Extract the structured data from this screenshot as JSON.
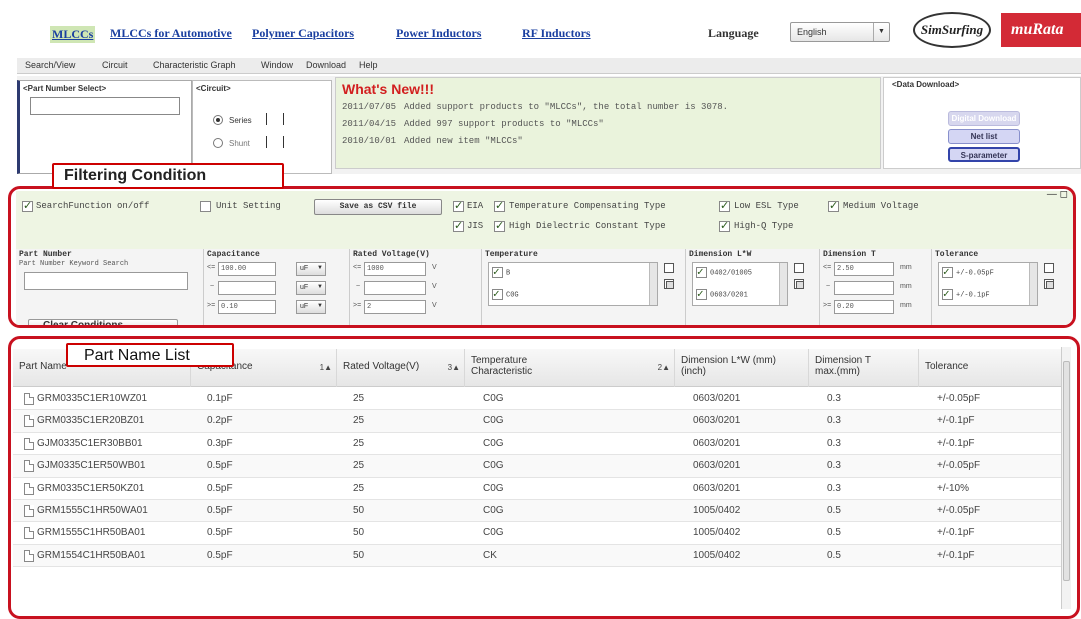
{
  "header": {
    "links": [
      "MLCCs",
      "MLCCs for Automotive",
      "Polymer Capacitors",
      "Power Inductors",
      "RF Inductors"
    ],
    "language_label": "Language",
    "language_value": "English",
    "simsurfing_logo": "SimSurfing",
    "brand_logo": "muRata"
  },
  "menu": [
    "Search/View",
    "Circuit",
    "Characteristic Graph",
    "Window",
    "Download",
    "Help"
  ],
  "part_select": {
    "label": "<Part Number Select>",
    "value": ""
  },
  "circuit": {
    "label": "<Circuit>",
    "options": [
      "Series",
      "Shunt"
    ],
    "selected": "Series"
  },
  "whats_new": {
    "title": "What's New!!!",
    "items": [
      {
        "date": "2011/07/05",
        "text": "Added support products to \"MLCCs\", the total number is 3078."
      },
      {
        "date": "2011/04/15",
        "text": "Added 997 support products to \"MLCCs\""
      },
      {
        "date": "2010/10/01",
        "text": "Added new item \"MLCCs\""
      }
    ]
  },
  "data_download": {
    "label": "<Data Download>",
    "buttons": [
      "Digital Download",
      "Net list",
      "S-parameter"
    ]
  },
  "filtering": {
    "callout": "Filtering Condition",
    "search_function": "SearchFunction on/off",
    "unit_setting": "Unit Setting",
    "save_csv": "Save as CSV file",
    "types_row1": [
      "EIA",
      "Temperature Compensating Type",
      "Low ESL Type",
      "Medium Voltage"
    ],
    "types_row2": [
      "JIS",
      "High Dielectric Constant Type",
      "High-Q Type"
    ],
    "part_number": {
      "title": "Part Number",
      "sub": "Part Number Keyword Search"
    },
    "capacitance": {
      "title": "Capacitance",
      "min": "100.00",
      "unit": "uF",
      "max": "0.10"
    },
    "rated_voltage": {
      "title": "Rated Voltage(V)",
      "min": "1000",
      "max": "2",
      "unit": "V"
    },
    "temperature": {
      "title": "Temperature",
      "items": [
        "B",
        "C0G"
      ]
    },
    "dimension_lw": {
      "title": "Dimension L*W",
      "items": [
        "0402/01005",
        "0603/0201"
      ]
    },
    "dimension_t": {
      "title": "Dimension T",
      "min": "2.50",
      "max": "0.20",
      "unit": "mm"
    },
    "tolerance": {
      "title": "Tolerance",
      "items": [
        "+/-0.05pF",
        "+/-0.1pF"
      ]
    },
    "clear": "Clear Conditions"
  },
  "part_list": {
    "callout": "Part Name List",
    "columns": [
      {
        "label": "Part Name",
        "sort": ""
      },
      {
        "label": "Capacitance",
        "sort": "1▲"
      },
      {
        "label": "Rated Voltage(V)",
        "sort": "3▲"
      },
      {
        "label": "Temperature Characteristic",
        "sort": "2▲"
      },
      {
        "label": "Dimension L*W (mm)(inch)",
        "sort": ""
      },
      {
        "label": "Dimension T max.(mm)",
        "sort": ""
      },
      {
        "label": "Tolerance",
        "sort": ""
      }
    ],
    "rows": [
      [
        "GRM0335C1ER10WZ01",
        "0.1pF",
        "25",
        "C0G",
        "0603/0201",
        "0.3",
        "+/-0.05pF"
      ],
      [
        "GRM0335C1ER20BZ01",
        "0.2pF",
        "25",
        "C0G",
        "0603/0201",
        "0.3",
        "+/-0.1pF"
      ],
      [
        "GJM0335C1ER30BB01",
        "0.3pF",
        "25",
        "C0G",
        "0603/0201",
        "0.3",
        "+/-0.1pF"
      ],
      [
        "GJM0335C1ER50WB01",
        "0.5pF",
        "25",
        "C0G",
        "0603/0201",
        "0.3",
        "+/-0.05pF"
      ],
      [
        "GRM0335C1ER50KZ01",
        "0.5pF",
        "25",
        "C0G",
        "0603/0201",
        "0.3",
        "+/-10%"
      ],
      [
        "GRM1555C1HR50WA01",
        "0.5pF",
        "50",
        "C0G",
        "1005/0402",
        "0.5",
        "+/-0.05pF"
      ],
      [
        "GRM1555C1HR50BA01",
        "0.5pF",
        "50",
        "C0G",
        "1005/0402",
        "0.5",
        "+/-0.1pF"
      ],
      [
        "GRM1554C1HR50BA01",
        "0.5pF",
        "50",
        "CK",
        "1005/0402",
        "0.5",
        "+/-0.1pF"
      ]
    ]
  }
}
